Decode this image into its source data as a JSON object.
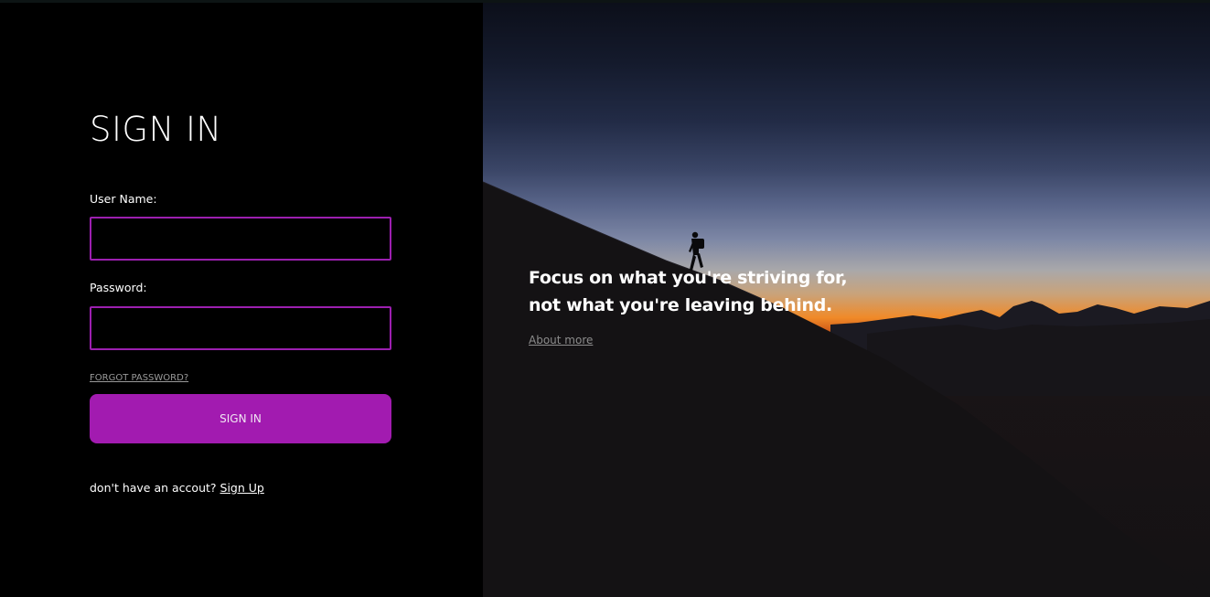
{
  "form": {
    "title": "SIGN IN",
    "username_label": "User Name:",
    "username_value": "",
    "password_label": "Password:",
    "password_value": "",
    "forgot_label": "FORGOT PASSWORD?",
    "submit_label": "SIGN IN",
    "signup_prompt": "don't have an accout?",
    "signup_link": "Sign Up"
  },
  "hero": {
    "quote_line1": "Focus on what you're striving for,",
    "quote_line2": "not what you're leaving behind.",
    "about_label": "About more"
  },
  "colors": {
    "accent": "#a21bb0",
    "input_border": "#9c1fb0",
    "background": "#000000",
    "sunset": "#f08a28"
  }
}
